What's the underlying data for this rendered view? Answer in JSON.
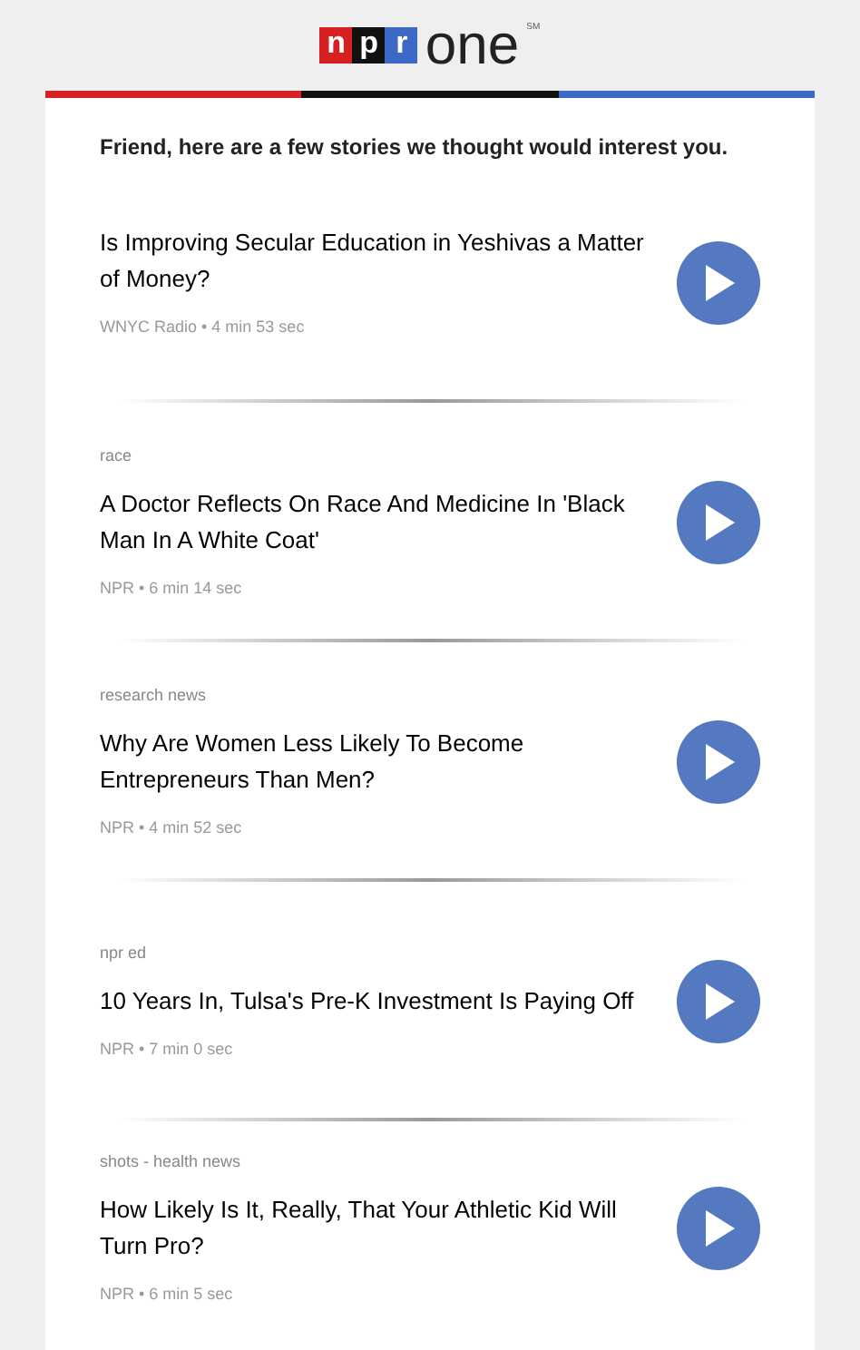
{
  "logo": {
    "letters": [
      "n",
      "p",
      "r"
    ],
    "word": "one",
    "mark": "SM"
  },
  "intro": "Friend, here are a few stories we thought would interest you.",
  "stories": [
    {
      "title": "Is Improving Secular Education in Yeshivas a Matter of Money?",
      "meta": "WNYC Radio • 4 min 53 sec"
    },
    {
      "category": "race",
      "title": "A Doctor Reflects On Race And Medicine In 'Black Man In A White Coat'",
      "meta": "NPR • 6 min 14 sec"
    },
    {
      "category": "research news",
      "title": "Why Are Women Less Likely To Become Entrepreneurs Than Men?",
      "meta": "NPR • 4 min 52 sec"
    },
    {
      "category": "npr ed",
      "title": "10 Years In, Tulsa's Pre-K Investment Is Paying Off",
      "meta": "NPR • 7 min 0 sec"
    },
    {
      "category": "shots - health news",
      "title": "How Likely Is It, Really, That Your Athletic Kid Will Turn Pro?",
      "meta": "NPR • 6 min 5 sec"
    }
  ]
}
